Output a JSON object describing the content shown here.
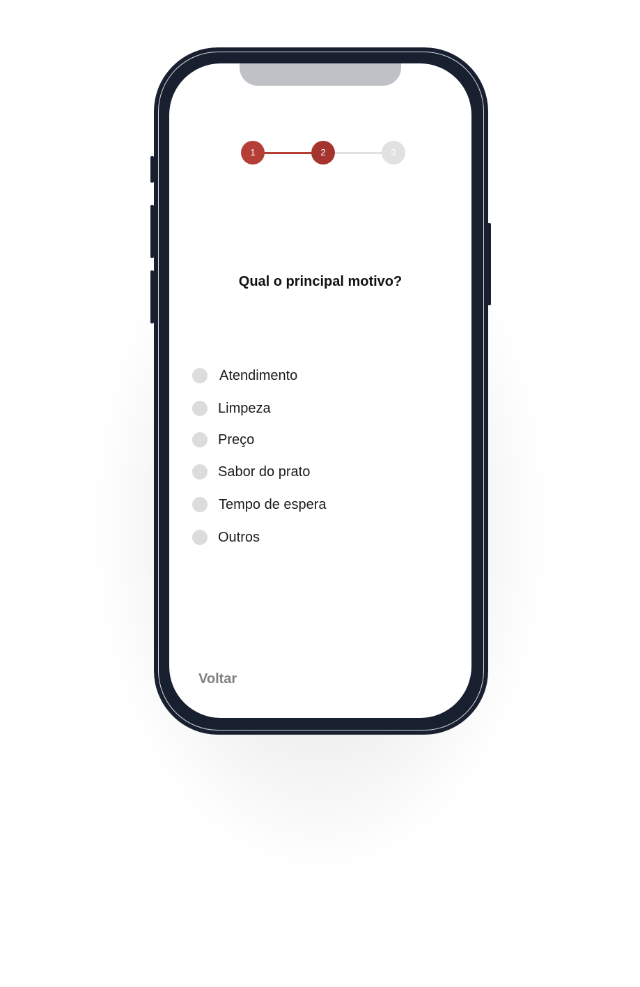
{
  "colors": {
    "accent": "#b53f37",
    "accent_dark": "#a5342e",
    "inactive": "#e1e1e1",
    "radio": "#dcdcdc",
    "device_frame": "#18202f"
  },
  "stepper": {
    "current_step": 2,
    "steps": [
      {
        "label": "1",
        "state": "done"
      },
      {
        "label": "2",
        "state": "current"
      },
      {
        "label": "3",
        "state": "pending"
      }
    ]
  },
  "question": "Qual o principal motivo?",
  "options": [
    {
      "label": "Atendimento",
      "selected": false
    },
    {
      "label": "Limpeza",
      "selected": false
    },
    {
      "label": "Preço",
      "selected": false
    },
    {
      "label": "Sabor do prato",
      "selected": false
    },
    {
      "label": "Tempo de espera",
      "selected": false
    },
    {
      "label": "Outros",
      "selected": false
    }
  ],
  "footer": {
    "back_label": "Voltar"
  }
}
